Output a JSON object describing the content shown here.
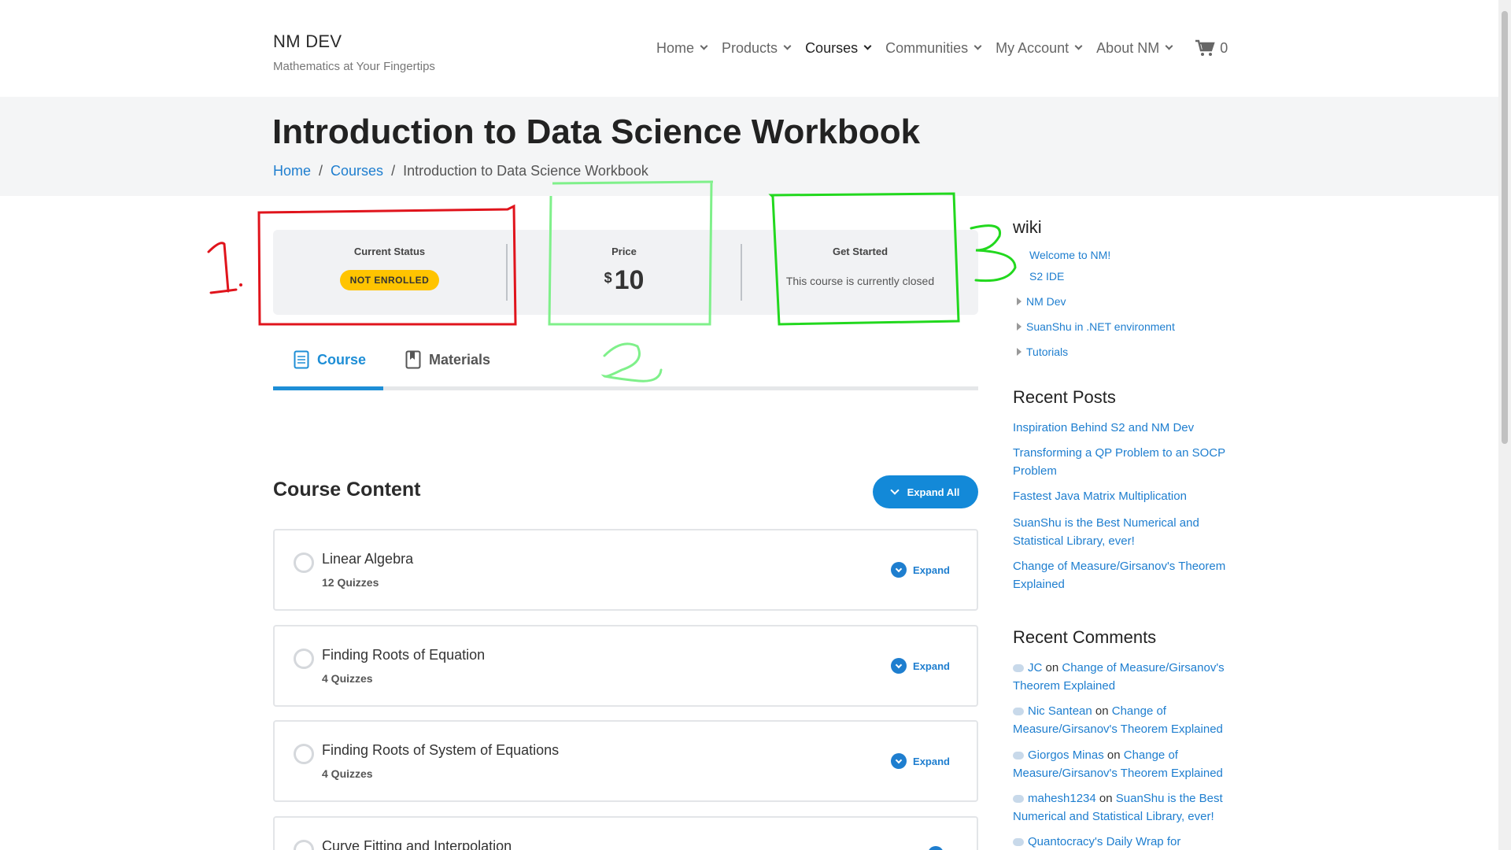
{
  "header": {
    "brand_title": "NM DEV",
    "brand_tagline": "Mathematics at Your Fingertips",
    "nav": [
      {
        "label": "Home"
      },
      {
        "label": "Products"
      },
      {
        "label": "Courses"
      },
      {
        "label": "Communities"
      },
      {
        "label": "My Account"
      },
      {
        "label": "About NM"
      }
    ],
    "cart_count": "0"
  },
  "page": {
    "title": "Introduction to Data Science Workbook",
    "breadcrumb": [
      "Home",
      "Courses",
      "Introduction to Data Science Workbook"
    ]
  },
  "status": {
    "current_status_label": "Current Status",
    "current_status_value": "NOT ENROLLED",
    "price_label": "Price",
    "price_currency": "$",
    "price_amount": "10",
    "get_started_label": "Get Started",
    "get_started_text": "This course is currently closed"
  },
  "tabs": [
    {
      "label": "Course"
    },
    {
      "label": "Materials"
    }
  ],
  "course_content": {
    "title": "Course Content",
    "expand_all_label": "Expand All",
    "lessons": [
      {
        "title": "Linear Algebra",
        "subtitle": "12 Quizzes",
        "expand": "Expand"
      },
      {
        "title": "Finding Roots of Equation",
        "subtitle": "4 Quizzes",
        "expand": "Expand"
      },
      {
        "title": "Finding Roots of System of Equations",
        "subtitle": "4 Quizzes",
        "expand": "Expand"
      },
      {
        "title": "Curve Fitting and Interpolation",
        "subtitle": "",
        "expand": "Expand"
      }
    ]
  },
  "sidebar": {
    "wiki_title": "wiki",
    "wiki_items": [
      "Welcome to NM!",
      "S2 IDE",
      "NM Dev",
      "SuanShu in .NET environment",
      "Tutorials"
    ],
    "recent_posts_title": "Recent Posts",
    "recent_posts": [
      "Inspiration Behind S2 and NM Dev",
      "Transforming a QP Problem to an SOCP Problem",
      "Fastest Java Matrix Multiplication",
      "SuanShu is the Best Numerical and Statistical Library, ever!",
      "Change of Measure/Girsanov's Theorem Explained"
    ],
    "recent_comments_title": "Recent Comments",
    "recent_comments": [
      {
        "author": "JC",
        "on": "on",
        "post": "Change of Measure/Girsanov's Theorem Explained"
      },
      {
        "author": "Nic Santean",
        "on": "on",
        "post": "Change of Measure/Girsanov's Theorem Explained"
      },
      {
        "author": "Giorgos Minas",
        "on": "on",
        "post": "Change of Measure/Girsanov's Theorem Explained"
      },
      {
        "author": "mahesh1234",
        "on": "on",
        "post": "SuanShu is the Best Numerical and Statistical Library, ever!"
      },
      {
        "author": "Quantocracy's Daily Wrap for",
        "on": "",
        "post": ""
      }
    ]
  },
  "annotations": {
    "label_1": "1.",
    "label_2": "2",
    "label_3": "3",
    "color_red": "#e0141c",
    "color_light_green": "#7ff08a",
    "color_green": "#22d81e"
  },
  "colors": {
    "accent": "#1e7ecf",
    "badge": "#ffc400",
    "banner_bg": "#f4f5f6"
  }
}
